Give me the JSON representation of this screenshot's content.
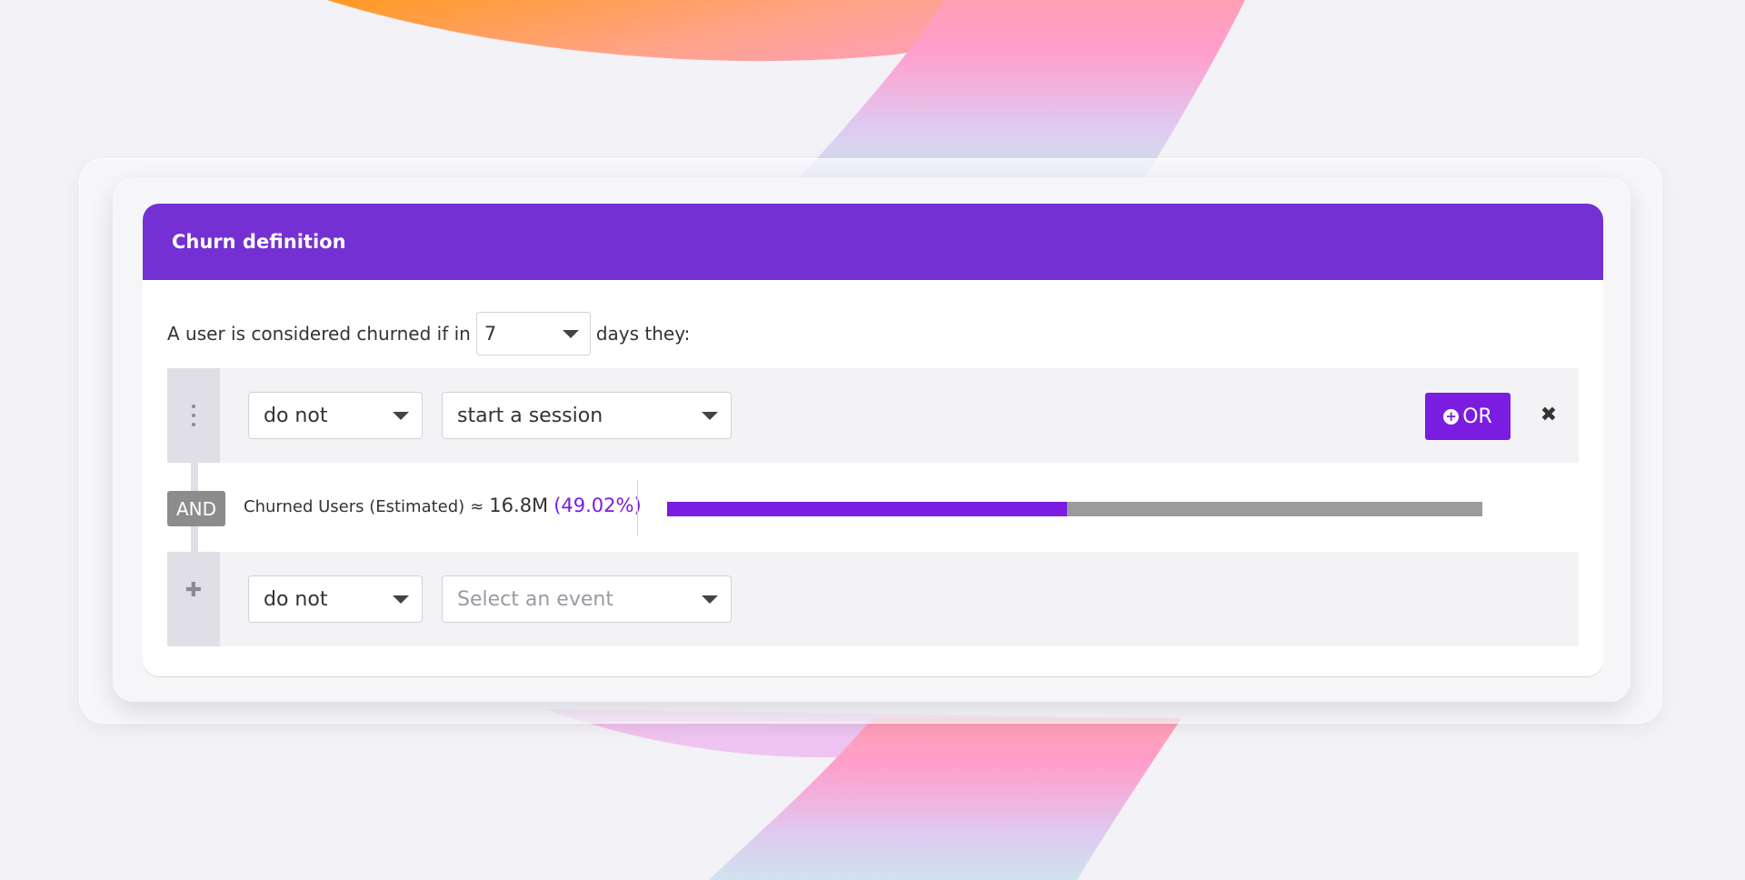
{
  "panel": {
    "title": "Churn definition"
  },
  "sentence": {
    "prefix": "A user is considered churned if in",
    "days_value": "7",
    "suffix": "days they:"
  },
  "conditions": [
    {
      "modal": "do not",
      "event": "start a session",
      "event_is_placeholder": false
    },
    {
      "modal": "do not",
      "event": "Select an event",
      "event_is_placeholder": true
    }
  ],
  "or_button": {
    "label": "OR"
  },
  "and_badge": {
    "label": "AND"
  },
  "estimate": {
    "label": "Churned Users (Estimated)",
    "approx": "≈",
    "value": "16.8M",
    "percent": "(49.02%)",
    "fraction": 0.4902
  },
  "colors": {
    "header": "#7430d2",
    "accent": "#7b1de0",
    "bar_remainder": "#9b9b9b"
  },
  "icons": {
    "row_handle": "kebab-menu-icon",
    "add_row": "plus-icon",
    "or_add": "plus-circle-icon",
    "remove": "close-icon",
    "dropdown": "caret-down-icon"
  }
}
